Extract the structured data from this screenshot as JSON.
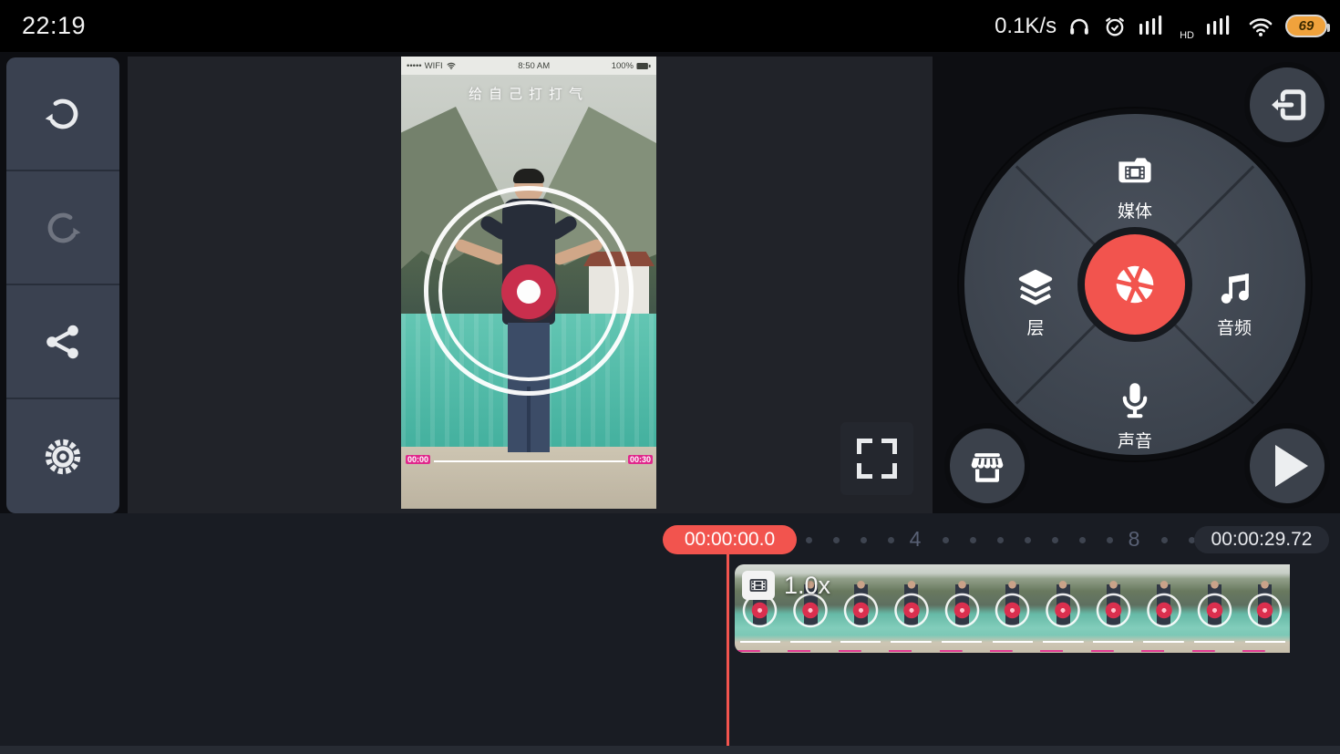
{
  "status_bar": {
    "time": "22:19",
    "net_speed": "0.1K/s",
    "hd_label": "HD",
    "battery_percent": "69"
  },
  "preview": {
    "phone_status": {
      "signal_dots": "•••••",
      "carrier": "WIFI",
      "time": "8:50 AM",
      "battery": "100%"
    },
    "overlay_text": "给自己打打气",
    "progress_time_left": "00:00",
    "progress_time_right": "00:30"
  },
  "wheel": {
    "items": [
      {
        "id": "media",
        "label": "媒体"
      },
      {
        "id": "layer",
        "label": "层"
      },
      {
        "id": "audio",
        "label": "音频"
      },
      {
        "id": "voice",
        "label": "声音"
      }
    ]
  },
  "timeline": {
    "playhead_time": "00:00:00.0",
    "total_duration": "00:00:29.72",
    "clip_speed_label": "1.0x",
    "ruler_ticks": [
      {
        "t": "dot"
      },
      {
        "t": "dot"
      },
      {
        "t": "dot"
      },
      {
        "t": "dot"
      },
      {
        "t": "num",
        "label": "4"
      },
      {
        "t": "dot"
      },
      {
        "t": "dot"
      },
      {
        "t": "dot"
      },
      {
        "t": "dot"
      },
      {
        "t": "dot"
      },
      {
        "t": "dot"
      },
      {
        "t": "dot"
      },
      {
        "t": "num",
        "label": "8"
      },
      {
        "t": "dot"
      },
      {
        "t": "dot"
      }
    ],
    "clip_tile_count": 12
  },
  "colors": {
    "accent_red": "#F2544E",
    "record_red": "#C92F4D",
    "pink_marker": "#E23A92",
    "battery_amber": "#F0A23C",
    "panel_gray": "#3A4150"
  }
}
